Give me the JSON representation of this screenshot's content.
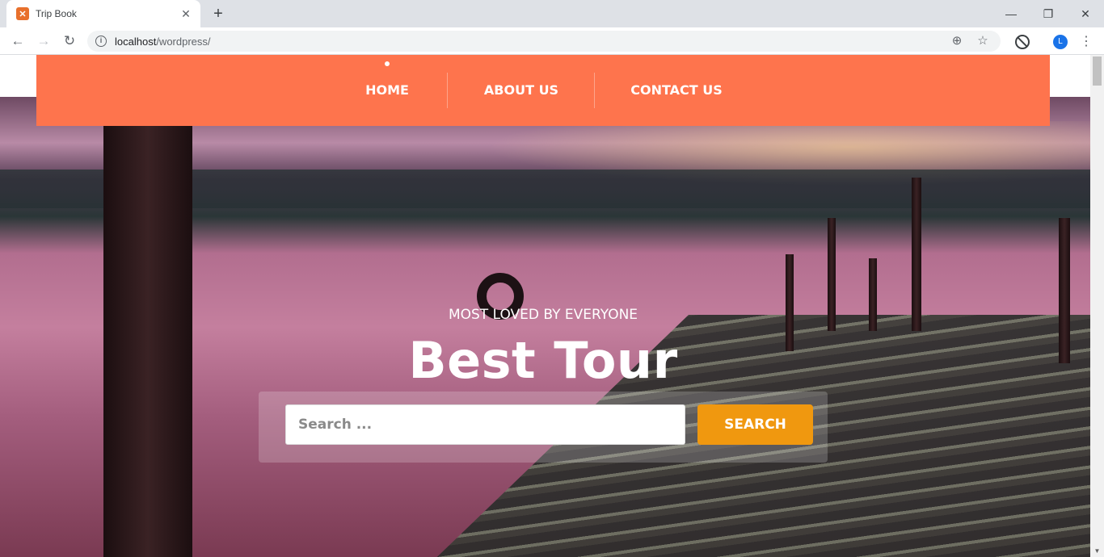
{
  "browser": {
    "tab_title": "Trip Book",
    "new_tab": "+",
    "url_host": "localhost",
    "url_path": "/wordpress/",
    "avatar_letter": "L"
  },
  "nav": {
    "items": [
      {
        "label": "HOME"
      },
      {
        "label": "ABOUT US"
      },
      {
        "label": "CONTACT US"
      }
    ]
  },
  "hero": {
    "subtitle": "MOST LOVED BY EVERYONE",
    "headline": "Best Tour",
    "search_placeholder": "Search ...",
    "search_button": "SEARCH"
  },
  "colors": {
    "nav_background": "#fe744d",
    "search_button": "#f0980f"
  },
  "icons": [
    "xampp-favicon-icon",
    "close-icon",
    "back-icon",
    "forward-icon",
    "reload-icon",
    "info-icon",
    "zoom-icon",
    "star-icon",
    "block-extension-icon",
    "menu-dots-icon"
  ]
}
